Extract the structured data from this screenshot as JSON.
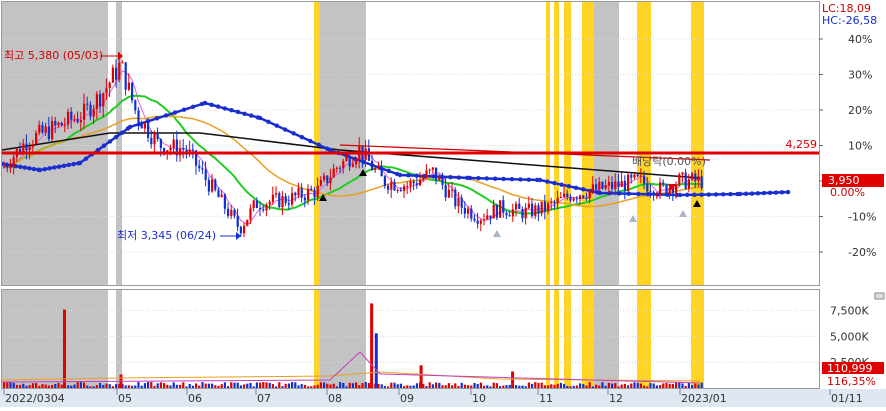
{
  "indicators": {
    "lc": "LC:18,09",
    "hc": "HC:-26,58"
  },
  "annotations": {
    "high": "최고 5,380 (05/03)",
    "low": "최저 3,345 (06/24)",
    "dividend": "배당락(0.00%)"
  },
  "levels": {
    "resistance": "4,259",
    "current": "3,950",
    "zero": "0.00%"
  },
  "volume_labels": {
    "current": "110,999",
    "ratio": "116,35%"
  },
  "colors": {
    "up": "#e00000",
    "down": "#1030d0",
    "highlight": "#ffcc00",
    "shade": "#b8b8b8",
    "ma_green": "#22cc22",
    "ma_orange": "#e8a020",
    "ma_black": "#000000",
    "ma_blue": "#1a2ed0"
  },
  "chart_data": [
    {
      "type": "candlestick",
      "title": "",
      "x_ticks": [
        "2022/03",
        "04",
        "05",
        "06",
        "07",
        "08",
        "09",
        "10",
        "11",
        "12",
        "2023/01",
        "01/11"
      ],
      "y_axis_ticks": [
        "40%",
        "30%",
        "20%",
        "10%",
        "0.00%",
        "-10%",
        "-20%"
      ],
      "y_axis_range_pct": [
        -27,
        45
      ],
      "reference_price": 3950,
      "high": {
        "price": 5380,
        "date": "05/03"
      },
      "low": {
        "price": 3345,
        "date": "06/24"
      },
      "horizontal_line": 4259,
      "close_points": [
        {
          "x": "03/01",
          "y": 4100
        },
        {
          "x": "03/15",
          "y": 4400
        },
        {
          "x": "04/01",
          "y": 4550
        },
        {
          "x": "04/15",
          "y": 4700
        },
        {
          "x": "04/25",
          "y": 4950
        },
        {
          "x": "05/03",
          "y": 5250
        },
        {
          "x": "05/10",
          "y": 4700
        },
        {
          "x": "05/20",
          "y": 4350
        },
        {
          "x": "06/01",
          "y": 4300
        },
        {
          "x": "06/10",
          "y": 3950
        },
        {
          "x": "06/24",
          "y": 3420
        },
        {
          "x": "07/01",
          "y": 3700
        },
        {
          "x": "07/15",
          "y": 3750
        },
        {
          "x": "07/28",
          "y": 3850
        },
        {
          "x": "08/05",
          "y": 4100
        },
        {
          "x": "08/15",
          "y": 4300
        },
        {
          "x": "08/25",
          "y": 3950
        },
        {
          "x": "09/05",
          "y": 3900
        },
        {
          "x": "09/15",
          "y": 4050
        },
        {
          "x": "09/25",
          "y": 3700
        },
        {
          "x": "10/05",
          "y": 3550
        },
        {
          "x": "10/15",
          "y": 3650
        },
        {
          "x": "10/25",
          "y": 3600
        },
        {
          "x": "11/05",
          "y": 3650
        },
        {
          "x": "11/15",
          "y": 3800
        },
        {
          "x": "11/25",
          "y": 3850
        },
        {
          "x": "12/05",
          "y": 3900
        },
        {
          "x": "12/15",
          "y": 3950
        },
        {
          "x": "12/25",
          "y": 3850
        },
        {
          "x": "2023/01/02",
          "y": 3950
        }
      ]
    },
    {
      "type": "bar",
      "title": "",
      "y_axis_ticks": [
        "7,500K",
        "5,000K",
        "2,500K"
      ],
      "y_axis_range": [
        0,
        9500
      ],
      "current_volume": 110999,
      "volume_ratio_pct": 116.35,
      "spikes_k": [
        {
          "x": "04/05",
          "y": 7600
        },
        {
          "x": "05/03",
          "y": 1300
        },
        {
          "x": "08/20",
          "y": 8200
        },
        {
          "x": "08/22",
          "y": 5300
        },
        {
          "x": "09/10",
          "y": 2200
        },
        {
          "x": "10/20",
          "y": 1600
        }
      ]
    }
  ]
}
